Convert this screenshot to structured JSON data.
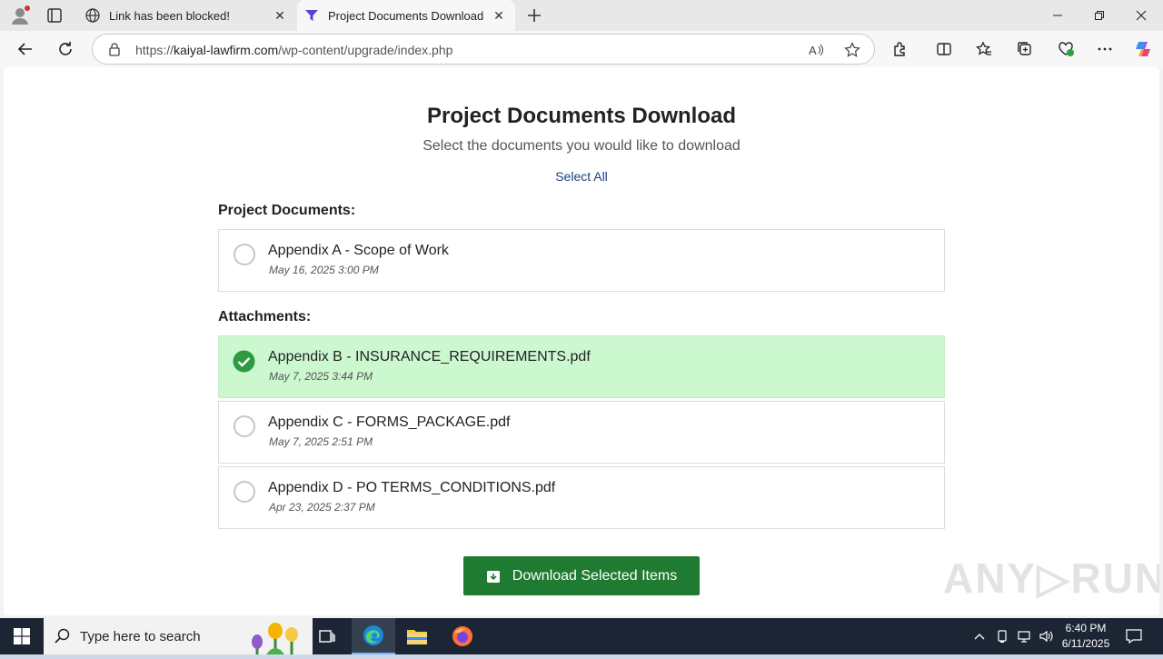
{
  "browser": {
    "tabs": [
      {
        "title": "Link has been blocked!",
        "icon": "globe-icon"
      },
      {
        "title": "Project Documents Download",
        "icon": "funnel-icon"
      }
    ],
    "address": {
      "scheme": "https://",
      "host": "kaiyal-lawfirm.com",
      "path": "/wp-content/upgrade/index.php"
    }
  },
  "page": {
    "title": "Project Documents Download",
    "subtitle": "Select the documents you would like to download",
    "select_all": "Select All",
    "sections": [
      {
        "heading": "Project Documents:",
        "documents": [
          {
            "name": "Appendix A - Scope of Work",
            "date": "May 16, 2025 3:00 PM",
            "selected": false
          }
        ]
      },
      {
        "heading": "Attachments:",
        "documents": [
          {
            "name": "Appendix B - INSURANCE_REQUIREMENTS.pdf",
            "date": "May 7, 2025 3:44 PM",
            "selected": true
          },
          {
            "name": "Appendix C - FORMS_PACKAGE.pdf",
            "date": "May 7, 2025 2:51 PM",
            "selected": false
          },
          {
            "name": "Appendix D - PO TERMS_CONDITIONS.pdf",
            "date": "Apr 23, 2025 2:37 PM",
            "selected": false
          }
        ]
      }
    ],
    "download_button": "Download Selected Items",
    "accent_color": "#1f7a32",
    "selected_color": "#ccf8d0",
    "watermark": "ANY RUN"
  },
  "taskbar": {
    "search_placeholder": "Type here to search",
    "time": "6:40 PM",
    "date": "6/11/2025"
  }
}
